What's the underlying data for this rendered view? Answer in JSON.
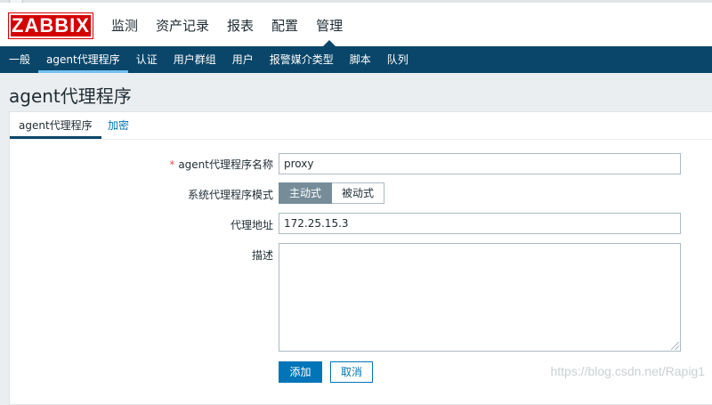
{
  "app": {
    "logo": "ZABBIX"
  },
  "main_nav": [
    {
      "label": "监测",
      "active": false
    },
    {
      "label": "资产记录",
      "active": false
    },
    {
      "label": "报表",
      "active": false
    },
    {
      "label": "配置",
      "active": false
    },
    {
      "label": "管理",
      "active": true
    }
  ],
  "sub_nav": [
    {
      "label": "一般"
    },
    {
      "label": "agent代理程序"
    },
    {
      "label": "认证"
    },
    {
      "label": "用户群组"
    },
    {
      "label": "用户"
    },
    {
      "label": "报警媒介类型"
    },
    {
      "label": "脚本"
    },
    {
      "label": "队列"
    }
  ],
  "page": {
    "title": "agent代理程序"
  },
  "tabs": {
    "active": "agent代理程序",
    "other": "加密"
  },
  "form": {
    "name_required_mark": "*",
    "name_label": "agent代理程序名称",
    "name_value": "proxy",
    "mode_label": "系统代理程序模式",
    "mode_active": "主动式",
    "mode_passive": "被动式",
    "address_label": "代理地址",
    "address_value": "172.25.15.3",
    "description_label": "描述",
    "description_value": "",
    "add_button": "添加",
    "cancel_button": "取消"
  },
  "watermark": "https://blog.csdn.net/Rapig1"
}
